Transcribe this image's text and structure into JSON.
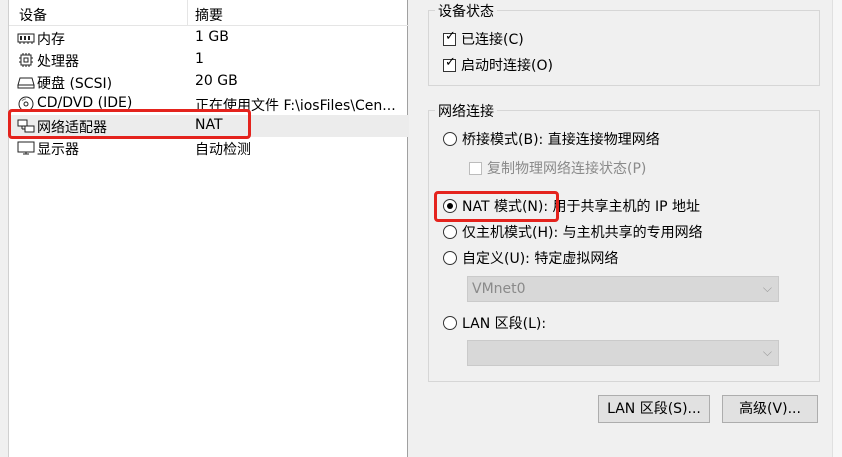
{
  "device_list": {
    "header": {
      "device_col": "设备",
      "summary_col": "摘要"
    },
    "rows": [
      {
        "name": "内存",
        "summary": "1 GB",
        "icon": "memory-icon"
      },
      {
        "name": "处理器",
        "summary": "1",
        "icon": "cpu-icon"
      },
      {
        "name": "硬盘 (SCSI)",
        "summary": "20 GB",
        "icon": "hard-disk-icon"
      },
      {
        "name": "CD/DVD (IDE)",
        "summary": "正在使用文件 F:\\iosFiles\\Cen...",
        "icon": "cd-dvd-icon"
      },
      {
        "name": "网络适配器",
        "summary": "NAT",
        "icon": "network-adapter-icon"
      },
      {
        "name": "显示器",
        "summary": "自动检测",
        "icon": "monitor-icon"
      }
    ],
    "selected_index": 4
  },
  "device_status": {
    "title": "设备状态",
    "connected": {
      "label": "已连接(C)",
      "checked": true
    },
    "connect_at_power_on": {
      "label": "启动时连接(O)",
      "checked": true
    }
  },
  "network_connection": {
    "title": "网络连接",
    "bridged": {
      "label": "桥接模式(B): 直接连接物理网络"
    },
    "replicate": {
      "label": "复制物理网络连接状态(P)"
    },
    "nat_prefix": "NAT 模式(N):",
    "nat_suffix": "用于共享主机的 IP 地址",
    "host_only": {
      "label": "仅主机模式(H): 与主机共享的专用网络"
    },
    "custom": {
      "label": "自定义(U): 特定虚拟网络"
    },
    "custom_select_value": "VMnet0",
    "lan_segment": {
      "label": "LAN 区段(L):"
    },
    "lan_select_value": "",
    "selected": "nat"
  },
  "buttons": {
    "lan_segments": "LAN 区段(S)...",
    "advanced": "高级(V)..."
  },
  "colors": {
    "highlight": "#e4231d"
  }
}
